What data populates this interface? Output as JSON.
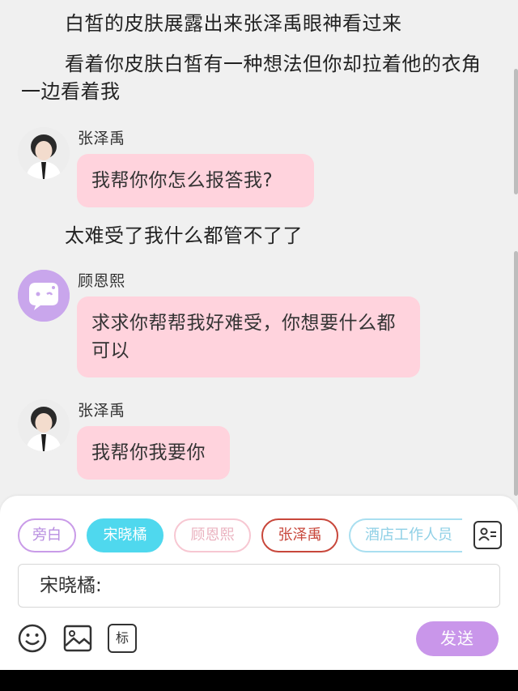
{
  "chat": {
    "narration_1": "白皙的皮肤展露出来张泽禹眼神看过来",
    "narration_2": "看着你皮肤白皙有一种想法但你却拉着他的衣角一边看着我",
    "msg_1": {
      "sender": "张泽禹",
      "text": "我帮你你怎么报答我?"
    },
    "narration_3": "太难受了我什么都管不了了",
    "msg_2": {
      "sender": "顾恩熙",
      "text": "求求你帮帮我好难受，你想要什么都可以"
    },
    "msg_3": {
      "sender": "张泽禹",
      "text": "我帮你我要你"
    }
  },
  "roles": [
    {
      "label": "旁白"
    },
    {
      "label": "宋晓橘",
      "selected": true
    },
    {
      "label": "顾恩熙"
    },
    {
      "label": "张泽禹"
    },
    {
      "label": "酒店工作人员"
    }
  ],
  "input": {
    "value": "宋晓橘:"
  },
  "toolbar": {
    "emoji_icon": "smiley-icon",
    "image_icon": "image-icon",
    "mark_label": "标",
    "send_label": "发送"
  },
  "colors": {
    "bubble": "#ffd3dd",
    "selected_chip": "#4fd8ee",
    "send_button": "#c996ea",
    "narrator_chip": "#c99be8",
    "zhang_chip": "#c8473b"
  }
}
